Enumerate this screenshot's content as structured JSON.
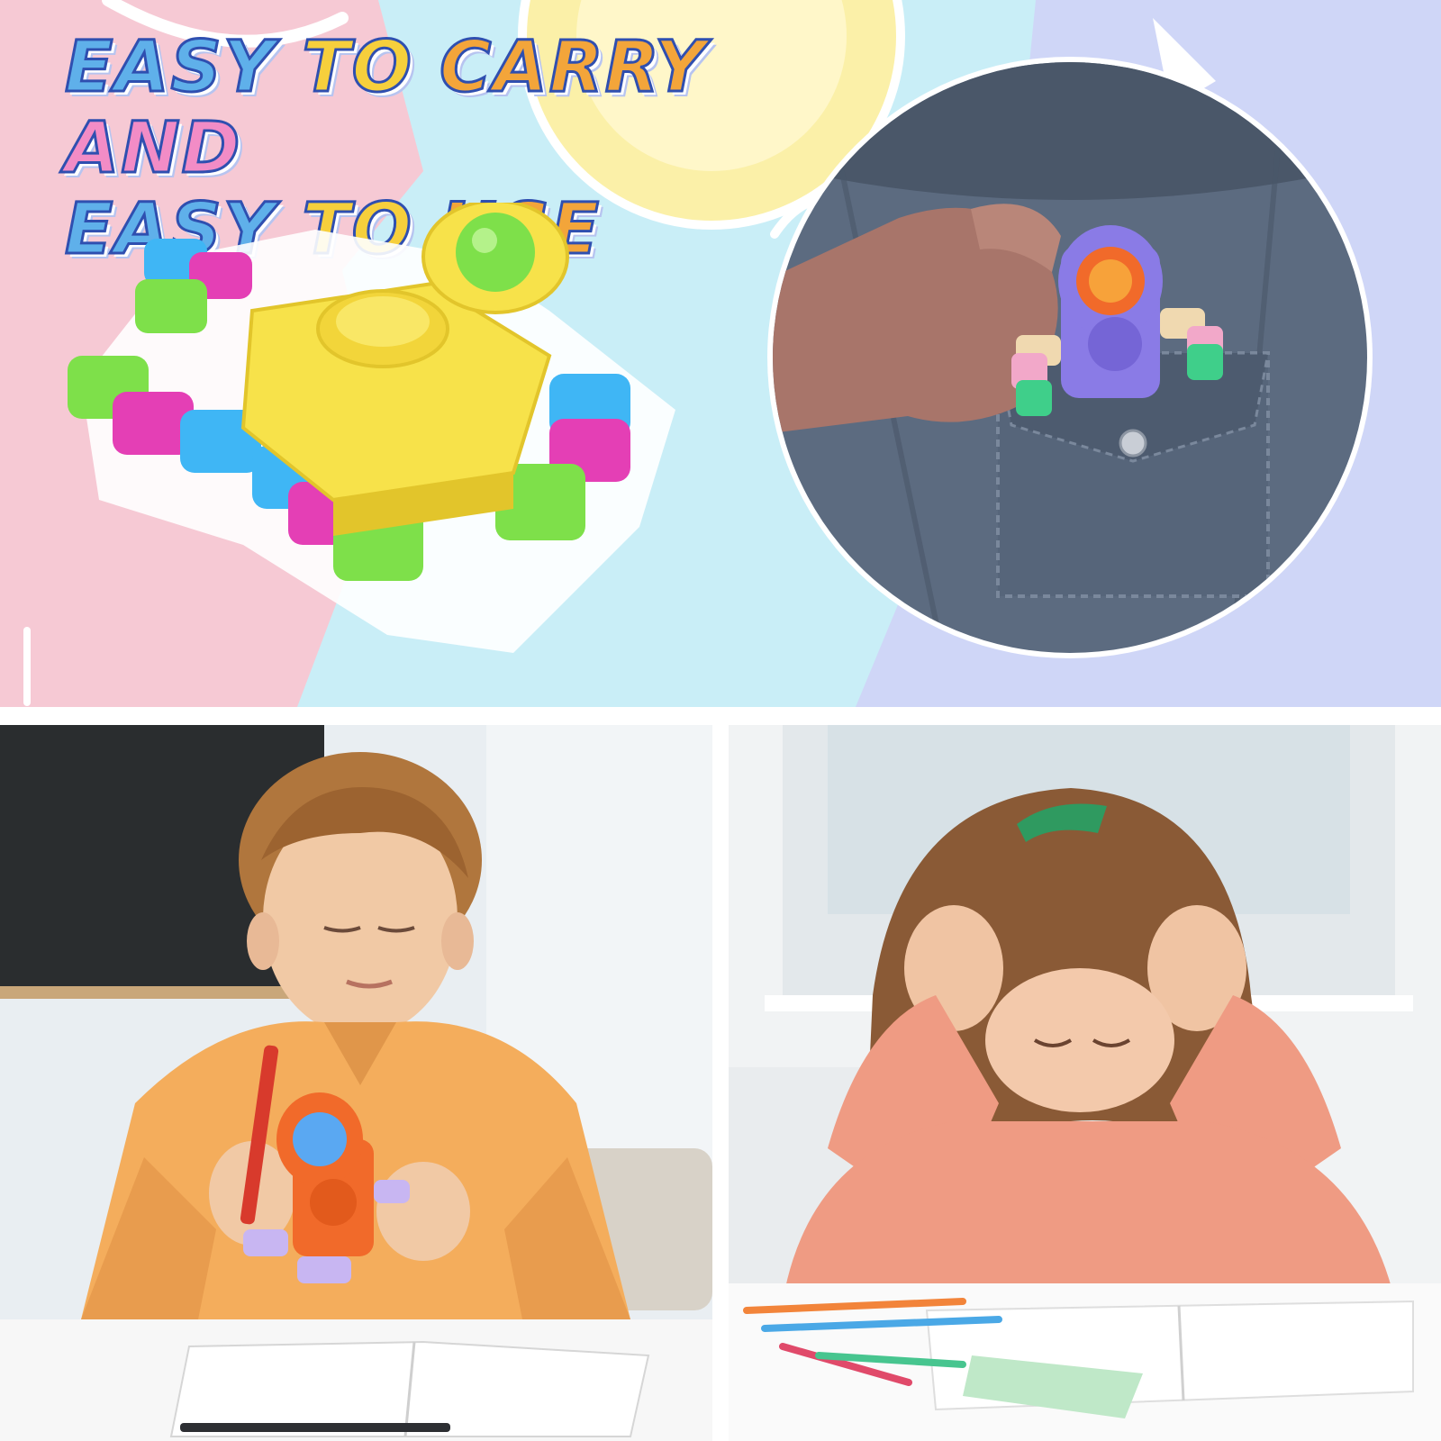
{
  "headline": {
    "line1_words": [
      "EASY",
      "TO",
      "CARRY",
      "AND"
    ],
    "line2_words": [
      "EASY",
      "TO",
      "USE"
    ]
  },
  "colors": {
    "bg_pink": "#f6c9d4",
    "bg_sky": "#c9eef7",
    "bg_periwinkle": "#cfd6f7",
    "sun_yellow": "#fbf0a8",
    "toy_yellow": "#f7e24a",
    "toy_green": "#7ee04a",
    "toy_blue": "#3fb6f5",
    "toy_magenta": "#e43fb5",
    "denim": "#5c6b80",
    "toy_purple": "#8a7be6",
    "toy_orange": "#f16a2a",
    "boy_shirt": "#f4ad5c",
    "girl_shirt": "#ef9b83"
  }
}
